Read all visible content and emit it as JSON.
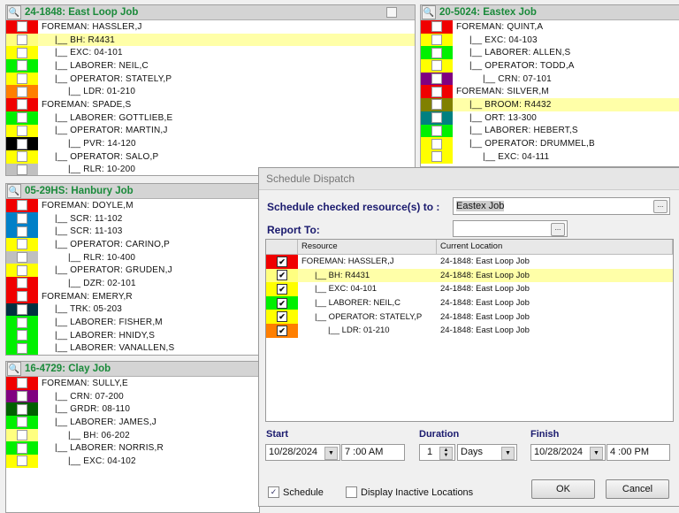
{
  "panels": [
    {
      "title": "24-1848: East Loop Job",
      "rows": [
        {
          "color": "#f00000",
          "level": 0,
          "label": "FOREMAN: HASSLER,J"
        },
        {
          "color": "#ffff80",
          "level": 1,
          "label": "|__ BH: R4431",
          "highlight": true
        },
        {
          "color": "#ffff00",
          "level": 1,
          "label": "|__ EXC: 04-101"
        },
        {
          "color": "#00f000",
          "level": 1,
          "label": "|__ LABORER: NEIL,C"
        },
        {
          "color": "#ffff00",
          "level": 1,
          "label": "|__ OPERATOR: STATELY,P"
        },
        {
          "color": "#ff7f00",
          "level": 2,
          "label": "|__ LDR: 01-210"
        },
        {
          "color": "#f00000",
          "level": 0,
          "label": "FOREMAN: SPADE,S"
        },
        {
          "color": "#00f000",
          "level": 1,
          "label": "|__ LABORER: GOTTLIEB,E"
        },
        {
          "color": "#ffff00",
          "level": 1,
          "label": "|__ OPERATOR: MARTIN,J"
        },
        {
          "color": "#000000",
          "level": 2,
          "label": "|__ PVR: 14-120"
        },
        {
          "color": "#ffff00",
          "level": 1,
          "label": "|__ OPERATOR: SALO,P"
        },
        {
          "color": "#c0c0c0",
          "level": 2,
          "label": "|__ RLR: 10-200"
        }
      ]
    },
    {
      "title": "20-5024: Eastex Job",
      "rows": [
        {
          "color": "#f00000",
          "level": 0,
          "label": "FOREMAN: QUINT,A"
        },
        {
          "color": "#ffff00",
          "level": 1,
          "label": "|__ EXC: 04-103"
        },
        {
          "color": "#00f000",
          "level": 1,
          "label": "|__ LABORER: ALLEN,S"
        },
        {
          "color": "#ffff00",
          "level": 1,
          "label": "|__ OPERATOR: TODD,A"
        },
        {
          "color": "#800080",
          "level": 2,
          "label": "|__ CRN: 07-101"
        },
        {
          "color": "#f00000",
          "level": 0,
          "label": "FOREMAN: SILVER,M"
        },
        {
          "color": "#808000",
          "level": 1,
          "label": "|__ BROOM: R4432",
          "highlight": true
        },
        {
          "color": "#008080",
          "level": 1,
          "label": "|__ ORT: 13-300"
        },
        {
          "color": "#00f000",
          "level": 1,
          "label": "|__ LABORER: HEBERT,S"
        },
        {
          "color": "#ffff00",
          "level": 1,
          "label": "|__ OPERATOR: DRUMMEL,B"
        },
        {
          "color": "#ffff00",
          "level": 2,
          "label": "|__ EXC: 04-111"
        }
      ]
    },
    {
      "title": "05-29HS: Hanbury Job",
      "rows": [
        {
          "color": "#f00000",
          "level": 0,
          "label": "FOREMAN: DOYLE,M"
        },
        {
          "color": "#0080c8",
          "level": 1,
          "label": "|__ SCR: 11-102"
        },
        {
          "color": "#0080c8",
          "level": 1,
          "label": "|__ SCR: 11-103"
        },
        {
          "color": "#ffff00",
          "level": 1,
          "label": "|__ OPERATOR: CARINO,P"
        },
        {
          "color": "#c0c0c0",
          "level": 2,
          "label": "|__ RLR: 10-400"
        },
        {
          "color": "#ffff00",
          "level": 1,
          "label": "|__ OPERATOR: GRUDEN,J"
        },
        {
          "color": "#f00000",
          "level": 2,
          "label": "|__ DZR: 02-101"
        },
        {
          "color": "#f00000",
          "level": 0,
          "label": "FOREMAN: EMERY,R"
        },
        {
          "color": "#003040",
          "level": 1,
          "label": "|__ TRK: 05-203"
        },
        {
          "color": "#00f000",
          "level": 1,
          "label": "|__ LABORER: FISHER,M"
        },
        {
          "color": "#00f000",
          "level": 1,
          "label": "|__ LABORER: HNIDY,S"
        },
        {
          "color": "#00f000",
          "level": 1,
          "label": "|__ LABORER: VANALLEN,S"
        }
      ]
    },
    {
      "title": "16-4729: Clay Job",
      "rows": [
        {
          "color": "#f00000",
          "level": 0,
          "label": "FOREMAN: SULLY,E"
        },
        {
          "color": "#800080",
          "level": 1,
          "label": "|__ CRN: 07-200"
        },
        {
          "color": "#006000",
          "level": 1,
          "label": "|__ GRDR: 08-110"
        },
        {
          "color": "#00f000",
          "level": 1,
          "label": "|__ LABORER: JAMES,J"
        },
        {
          "color": "#ffff80",
          "level": 2,
          "label": "|__ BH: 06-202"
        },
        {
          "color": "#00f000",
          "level": 1,
          "label": "|__ LABORER: NORRIS,R"
        },
        {
          "color": "#ffff00",
          "level": 2,
          "label": "|__ EXC: 04-102"
        }
      ]
    }
  ],
  "dialog": {
    "title": "Schedule Dispatch",
    "schedule_to_label": "Schedule checked resource(s) to :",
    "schedule_to_value": "Eastex Job",
    "report_to_label": "Report To:",
    "report_to_value": "",
    "browse_label": "...",
    "grid": {
      "headers": [
        "",
        "Resource",
        "Current Location"
      ],
      "rows": [
        {
          "color": "#f00000",
          "checked": true,
          "level": 0,
          "resource": "FOREMAN: HASSLER,J",
          "location": "24-1848: East Loop Job"
        },
        {
          "color": "#ffff80",
          "checked": true,
          "level": 1,
          "resource": "|__ BH: R4431",
          "location": "24-1848: East Loop Job",
          "highlight": true
        },
        {
          "color": "#ffff00",
          "checked": true,
          "level": 1,
          "resource": "|__ EXC: 04-101",
          "location": "24-1848: East Loop Job"
        },
        {
          "color": "#00f000",
          "checked": true,
          "level": 1,
          "resource": "|__ LABORER: NEIL,C",
          "location": "24-1848: East Loop Job"
        },
        {
          "color": "#ffff00",
          "checked": true,
          "level": 1,
          "resource": "|__ OPERATOR: STATELY,P",
          "location": "24-1848: East Loop Job"
        },
        {
          "color": "#ff7f00",
          "checked": true,
          "level": 2,
          "resource": "|__ LDR: 01-210",
          "location": "24-1848: East Loop Job"
        }
      ]
    },
    "start_label": "Start",
    "start_date": "10/28/2024",
    "start_time": "7 :00 AM",
    "duration_label": "Duration",
    "duration_value": "1",
    "duration_unit": "Days",
    "finish_label": "Finish",
    "finish_date": "10/28/2024",
    "finish_time": "4 :00 PM",
    "schedule_checkbox": {
      "label": "Schedule",
      "checked": true
    },
    "inactive_checkbox": {
      "label": "Display Inactive Locations",
      "checked": false
    },
    "ok_label": "OK",
    "cancel_label": "Cancel"
  }
}
